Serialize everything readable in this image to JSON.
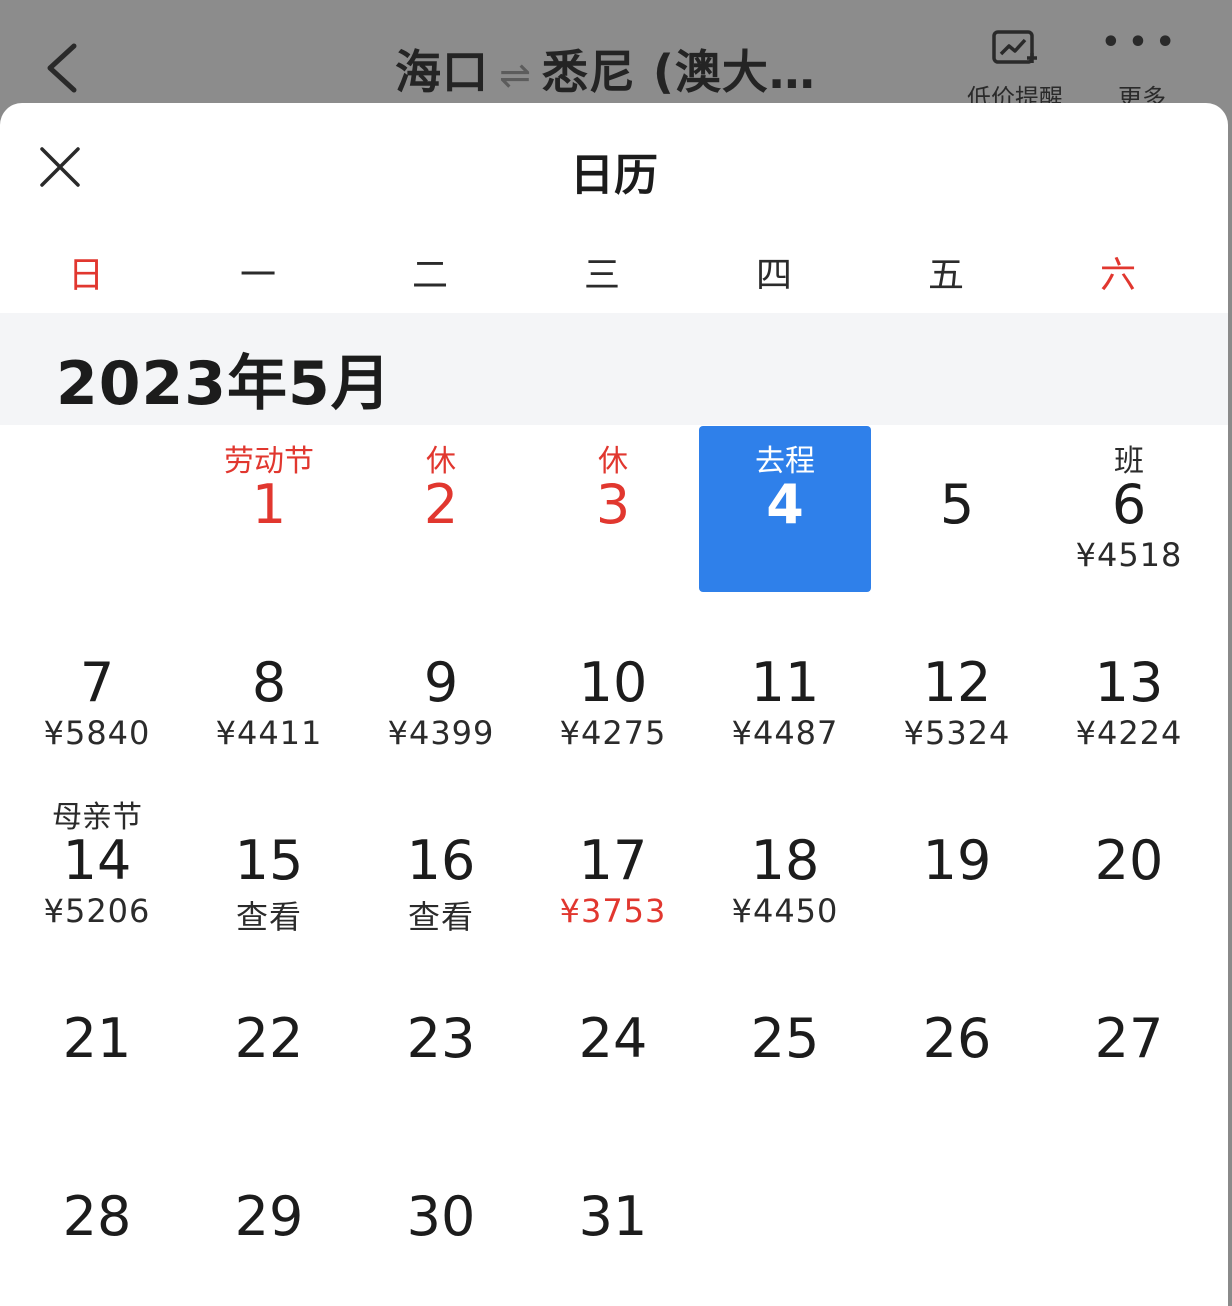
{
  "nav": {
    "route_from": "海口",
    "route_arrow": "⇌",
    "route_to": "悉尼 (澳大…",
    "alert_label": "低价提醒",
    "more_label": "更多",
    "more_icon": "ellipsis-icon",
    "back_icon": "chevron-left-icon",
    "alert_icon": "price-alert-chart-icon"
  },
  "sheet": {
    "title": "日历",
    "close_icon": "close-icon"
  },
  "weekdays": [
    "日",
    "一",
    "二",
    "三",
    "四",
    "五",
    "六"
  ],
  "month": {
    "title": "2023年5月"
  },
  "colors": {
    "accent": "#2f80ea",
    "holiday_red": "#e1372f",
    "text": "#1c1c1c",
    "month_band": "#f4f5f7"
  },
  "days": [
    {
      "day": "1",
      "tag": "劳动节",
      "price": "",
      "red_num": true,
      "red_tag": true
    },
    {
      "day": "2",
      "tag": "休",
      "price": "",
      "red_num": true,
      "red_tag": true
    },
    {
      "day": "3",
      "tag": "休",
      "price": "",
      "red_num": true,
      "red_tag": true
    },
    {
      "day": "4",
      "tag": "去程",
      "price": "",
      "selected": true
    },
    {
      "day": "5",
      "tag": "",
      "price": ""
    },
    {
      "day": "6",
      "tag": "班",
      "price": "¥4518"
    },
    {
      "day": "7",
      "tag": "",
      "price": "¥5840"
    },
    {
      "day": "8",
      "tag": "",
      "price": "¥4411"
    },
    {
      "day": "9",
      "tag": "",
      "price": "¥4399"
    },
    {
      "day": "10",
      "tag": "",
      "price": "¥4275"
    },
    {
      "day": "11",
      "tag": "",
      "price": "¥4487"
    },
    {
      "day": "12",
      "tag": "",
      "price": "¥5324"
    },
    {
      "day": "13",
      "tag": "",
      "price": "¥4224"
    },
    {
      "day": "14",
      "tag": "母亲节",
      "price": "¥5206"
    },
    {
      "day": "15",
      "tag": "",
      "price": "查看"
    },
    {
      "day": "16",
      "tag": "",
      "price": "查看"
    },
    {
      "day": "17",
      "tag": "",
      "price": "¥3753",
      "red_price": true
    },
    {
      "day": "18",
      "tag": "",
      "price": "¥4450"
    },
    {
      "day": "19",
      "tag": "",
      "price": ""
    },
    {
      "day": "20",
      "tag": "",
      "price": ""
    },
    {
      "day": "21",
      "tag": "",
      "price": ""
    },
    {
      "day": "22",
      "tag": "",
      "price": ""
    },
    {
      "day": "23",
      "tag": "",
      "price": ""
    },
    {
      "day": "24",
      "tag": "",
      "price": ""
    },
    {
      "day": "25",
      "tag": "",
      "price": ""
    },
    {
      "day": "26",
      "tag": "",
      "price": ""
    },
    {
      "day": "27",
      "tag": "",
      "price": ""
    },
    {
      "day": "28",
      "tag": "",
      "price": ""
    },
    {
      "day": "29",
      "tag": "",
      "price": ""
    },
    {
      "day": "30",
      "tag": "",
      "price": ""
    },
    {
      "day": "31",
      "tag": "",
      "price": ""
    }
  ]
}
